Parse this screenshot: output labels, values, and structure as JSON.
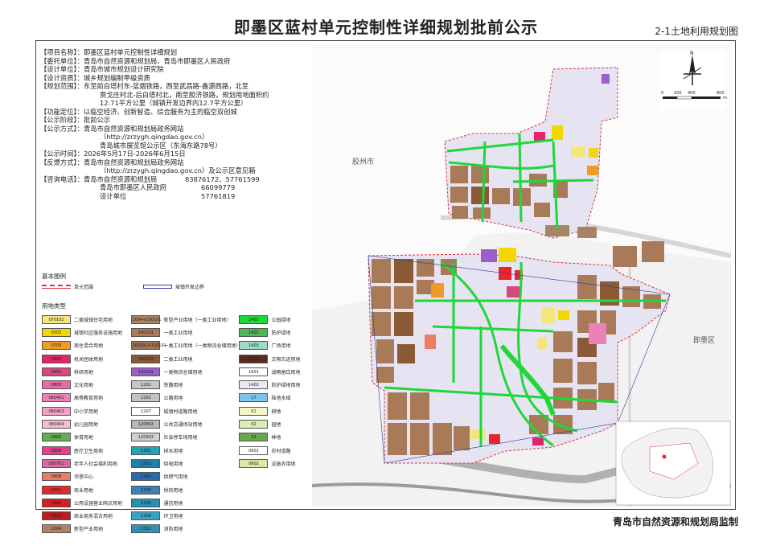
{
  "header": {
    "title": "即墨区蓝村单元控制性详细规划批前公示",
    "map_no": "2-1土地利用规划图"
  },
  "footer": {
    "agency": "青岛市自然资源和规划局监制"
  },
  "info": {
    "project_key": "【项目名称】：",
    "project_val": "即墨区蓝村单元控制性详细规划",
    "client_key": "【委托单位】：",
    "client_val": "青岛市自然资源和规划局、青岛市即墨区人民政府",
    "designer_key": "【设计单位】：",
    "designer_val": "青岛市城市规划设计研究院",
    "qual_key": "【设计资质】：",
    "qual_val": "城乡规划编制甲级资质",
    "scope_key": "【规划范围】：",
    "scope_val1": "东至前白塔村东-蓝烟铁路，西至武昌路-鑫源西路，北至",
    "scope_val2": "贾戈庄村北-后白塔村北，南至胶济铁路，规划用地面积约",
    "scope_val3": "12.71平方公里（城镇开发边界内12.7平方公里）",
    "func_key": "【功能定位】：",
    "func_val": "以临空经济、创新智造、综合服务为主的临空双创城",
    "stage_key": "【公示阶段】：",
    "stage_val": "批前公示",
    "method_key": "【公示方式】：",
    "method_val1": "青岛市自然资源和规划局政务网站",
    "method_val2": "（http://zrzygh.qingdao.gov.cn）",
    "method_val3": "青岛城市展览馆公示区（东海东路78号）",
    "time_key": "【公示时间】：",
    "time_val": "2026年5月17日-2026年6月15日",
    "feedback_key": "【反馈方式】：",
    "feedback_val1": "青岛市自然资源和规划局政务网站",
    "feedback_val2": "（http://zrzygh.qingdao.gov.cn）及公示区意见箱",
    "phone_key": "【咨询电话】：",
    "phone_org1": "青岛市自然资源和规划局",
    "phone_num1": "83876172、57761599",
    "phone_org2": "青岛市即墨区人民政府",
    "phone_num2": "66099779",
    "phone_org3": "设计单位",
    "phone_num3": "57761819"
  },
  "legend": {
    "basic_title": "基本图例",
    "unit_boundary": "单元范围",
    "dev_boundary": "城镇开发边界",
    "landuse_title": "用地类型",
    "col1": [
      {
        "code": "070102",
        "name": "二类城镇住宅用地",
        "color": "#f4e67e"
      },
      {
        "code": "0702",
        "name": "城镇社区服务设施用地",
        "color": "#f2d800"
      },
      {
        "code": "0703",
        "name": "商住混合用地",
        "color": "#f09a28"
      },
      {
        "code": "0801",
        "name": "机关团体用地",
        "color": "#e5226a"
      },
      {
        "code": "0802",
        "name": "科研用地",
        "color": "#d8487c"
      },
      {
        "code": "0803",
        "name": "文化用地",
        "color": "#e86aa6"
      },
      {
        "code": "080401",
        "name": "高等教育用地",
        "color": "#ec80b8"
      },
      {
        "code": "080403",
        "name": "中小学用地",
        "color": "#f3a0c6"
      },
      {
        "code": "080404",
        "name": "幼儿园用地",
        "color": "#f7bdd6"
      },
      {
        "code": "0805",
        "name": "体育用地",
        "color": "#5fb04e"
      },
      {
        "code": "0806",
        "name": "医疗卫生用地",
        "color": "#e83e8c"
      },
      {
        "code": "080701",
        "name": "老年人社会福利用地",
        "color": "#d86aa0"
      },
      {
        "code": "0808",
        "name": "邻里中心",
        "color": "#e97e62"
      },
      {
        "code": "0901",
        "name": "商业用地",
        "color": "#e8262c"
      },
      {
        "code": "0904",
        "name": "公用设施营业网点用地",
        "color": "#d81e1e"
      },
      {
        "code": "0903",
        "name": "商业商务混合用地",
        "color": "#b81c24"
      },
      {
        "code": "1004",
        "name": "新型产业用地",
        "color": "#b08060"
      }
    ],
    "col2": [
      {
        "code": "1004+100101",
        "name": "新型产业用地（一类工业用地）",
        "color": "#a88466"
      },
      {
        "code": "100101",
        "name": "一类工业用地",
        "color": "#a87a58"
      },
      {
        "code": "100101+110101",
        "name": "一类工业用地（一类物流仓储用地）",
        "color": "#9e7454"
      },
      {
        "code": "100102",
        "name": "二类工业用地",
        "color": "#8a5a36"
      },
      {
        "code": "110101",
        "name": "一类物流仓储用地",
        "color": "#9b5fc8"
      },
      {
        "code": "1201",
        "name": "铁路用地",
        "color": "#c6c6c6"
      },
      {
        "code": "1202",
        "name": "公路用地",
        "color": "#c2c2c2"
      },
      {
        "code": "1207",
        "name": "城镇村道路用地",
        "color": "#ffffff"
      },
      {
        "code": "120803",
        "name": "公共交通场站用地",
        "color": "#b7b7b7"
      },
      {
        "code": "120903",
        "name": "社会停车场用地",
        "color": "#d0d0d0"
      },
      {
        "code": "1301",
        "name": "排水用地",
        "color": "#29a3b8"
      },
      {
        "code": "1302",
        "name": "供电用地",
        "color": "#1f7fa8"
      },
      {
        "code": "1303",
        "name": "供燃气用地",
        "color": "#2b6ba8"
      },
      {
        "code": "1304",
        "name": "供热用地",
        "color": "#3e7fb5"
      },
      {
        "code": "1305",
        "name": "通信用地",
        "color": "#2c8fb2"
      },
      {
        "code": "1306",
        "name": "环卫用地",
        "color": "#3ba4c4"
      },
      {
        "code": "1310",
        "name": "消防用地",
        "color": "#3090b8"
      }
    ],
    "col3": [
      {
        "code": "1401",
        "name": "公园绿地",
        "color": "#1ed838"
      },
      {
        "code": "1402",
        "name": "防护绿地",
        "color": "#4eb858"
      },
      {
        "code": "1403",
        "name": "广场用地",
        "color": "#9edbc6"
      },
      {
        "code": "1503",
        "name": "文物古迹用地",
        "color": "#5a2a1e"
      },
      {
        "code": "1601",
        "name": "战略留白用地",
        "color": "#ffffff"
      },
      {
        "code": "1402",
        "name": "防护绿地用地",
        "color": "#e9e9f8"
      },
      {
        "code": "17",
        "name": "陆地水域",
        "color": "#7bc3f0"
      },
      {
        "code": "01",
        "name": "耕地",
        "color": "#f5f5c8"
      },
      {
        "code": "02",
        "name": "园地",
        "color": "#dbeeb0"
      },
      {
        "code": "03",
        "name": "林地",
        "color": "#6aa84f"
      },
      {
        "code": "0601",
        "name": "农村道路",
        "color": "#ffffff"
      },
      {
        "code": "0602",
        "name": "设施农用地",
        "color": "#dfe6a8"
      }
    ]
  },
  "map": {
    "label_jiaozhou": "胶州市",
    "label_jimo": "即墨区",
    "north_label": "N",
    "scale_ticks": [
      "0",
      "200",
      "400",
      "800"
    ],
    "scale_unit": "m"
  }
}
